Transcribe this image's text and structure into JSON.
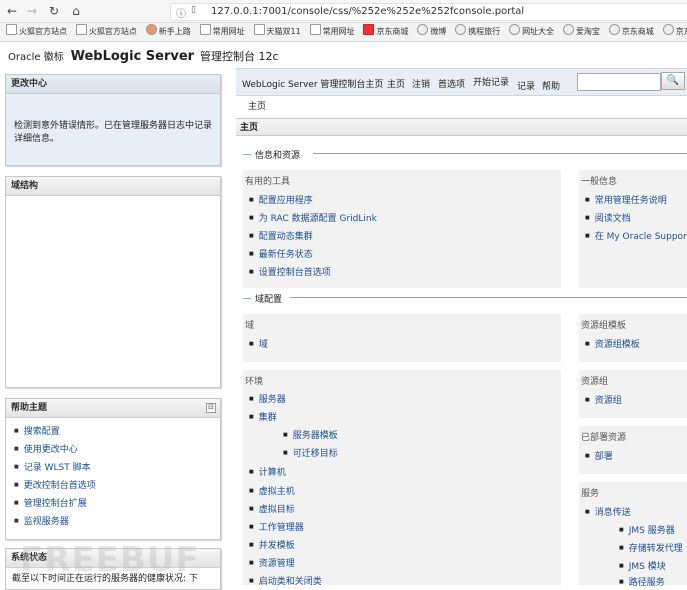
{
  "browser": {
    "back_icon": "back-arrow-icon",
    "forward_icon": "forward-arrow-icon",
    "reload_icon": "reload-icon",
    "home_icon": "home-icon",
    "url": "127.0.0.1:7001/console/css/%252e%252e%252fconsole.portal"
  },
  "bookmarks": [
    "火狐官方站点",
    "火狐官方站点",
    "新手上路",
    "常用网址",
    "天猫双11",
    "常用网址",
    "京东商城",
    "微博",
    "携程旅行",
    "网址大全",
    "爱淘宝",
    "京东商城",
    "京东"
  ],
  "header": {
    "oracle_logo": "Oracle 徽标",
    "product": "WebLogic Server",
    "console": "管理控制台 12c"
  },
  "change_center": {
    "title": "更改中心",
    "message": "检测到意外错误情形。已在管理服务器日志中记录详细信息。"
  },
  "domain_structure": {
    "title": "域结构"
  },
  "help_topics": {
    "title": "帮助主题",
    "collapse": "⊟",
    "items": [
      "搜索配置",
      "使用更改中心",
      "记录 WLST 脚本",
      "更改控制台首选项",
      "管理控制台扩展",
      "监视服务器"
    ]
  },
  "system_status": {
    "title": "系统状态",
    "text": "截至以下时间正在运行的服务器的健康状况: 下"
  },
  "topbar": {
    "home_text": "WebLogic Server 管理控制台主页",
    "links": [
      "主页",
      "注销",
      "首选项",
      "开始记录",
      "记录",
      "帮助"
    ],
    "search_placeholder": "",
    "search_icon": "search-icon"
  },
  "breadcrumb": "主页",
  "main": {
    "title": "主页",
    "section1": "信息和资源",
    "useful_tools": {
      "title": "有用的工具",
      "items": [
        "配置应用程序",
        "为 RAC 数据源配置 GridLink",
        "配置动态集群",
        "最新任务状态",
        "设置控制台首选项"
      ]
    },
    "general_info": {
      "title": "一般信息",
      "items": [
        "常用管理任务说明",
        "阅读文档",
        "在 My Oracle Support"
      ]
    },
    "section2": "域配置",
    "domain": {
      "title": "域",
      "items": [
        "域"
      ]
    },
    "resource_group_templates": {
      "title": "资源组模板",
      "items": [
        "资源组模板"
      ]
    },
    "environment": {
      "title": "环境",
      "items": [
        "服务器",
        "集群",
        "服务器模板",
        "可迁移目标",
        "计算机",
        "虚拟主机",
        "虚拟目标",
        "工作管理器",
        "并发模板",
        "资源管理",
        "启动类和关闭类"
      ]
    },
    "resource_groups": {
      "title": "资源组",
      "items": [
        "资源组"
      ]
    },
    "deployed_resources": {
      "title": "已部署资源",
      "items": [
        "部署"
      ]
    },
    "services": {
      "title": "服务",
      "items": [
        "消息传送",
        "JMS 服务器",
        "存储转发代理",
        "JMS 模块",
        "路径服务"
      ]
    }
  },
  "watermark": "FREEBUF"
}
